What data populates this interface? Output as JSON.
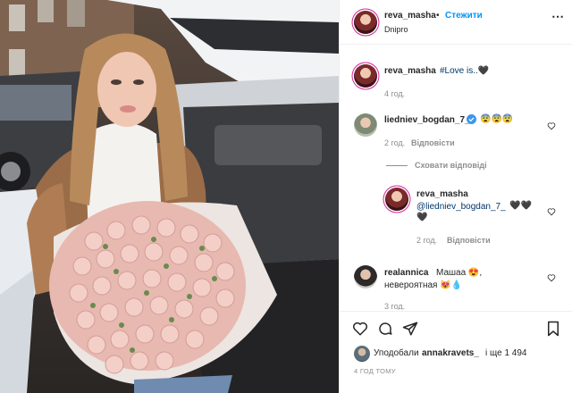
{
  "header": {
    "username": "reva_masha",
    "separator": "•",
    "follow_label": "Стежити",
    "location": "Dnipro"
  },
  "caption": {
    "username": "reva_masha",
    "text": "#Love is..🖤",
    "time": "4 год."
  },
  "comments": [
    {
      "username": "liedniev_bogdan_7_",
      "text": "😨😨😨",
      "time": "2 год.",
      "reply_label": "Відповісти",
      "verified": true
    },
    {
      "username": "realannica",
      "text_line1": "Машаа 😍,",
      "text_line2": "невероятная 😻💧",
      "time": "3 год."
    }
  ],
  "hide_replies_label": "Сховати відповіді",
  "reply": {
    "username": "reva_masha",
    "mention": "@liedniev_bogdan_7_",
    "hearts_line1": "🖤🖤",
    "hearts_line2": "🖤",
    "time": "2 год.",
    "reply_label": "Відповісти"
  },
  "likes": {
    "prefix": "Уподобали",
    "user": "annakravets_",
    "suffix": "і ще 1 494"
  },
  "post_time": "4 ГОД ТОМУ",
  "icons": [
    "heart-icon",
    "comment-icon",
    "share-icon",
    "bookmark-icon",
    "verified-icon"
  ],
  "colors": {
    "accent": "#0095f6",
    "verified": "#3897f0",
    "muted": "#8e8e8e",
    "text": "#262626"
  }
}
